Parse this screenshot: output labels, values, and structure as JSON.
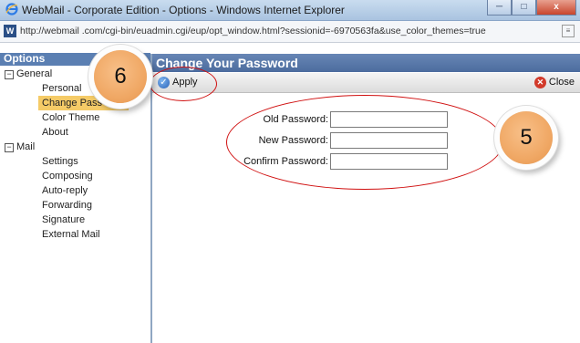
{
  "window": {
    "title": "WebMail - Corporate Edition - Options - Windows Internet Explorer",
    "minimize_label": "─",
    "maximize_label": "□",
    "close_label": "x"
  },
  "address_bar": {
    "url": "http://webmail         .com/cgi-bin/euadmin.cgi/eup/opt_window.html?sessionid=-6970563fa&use_color_themes=true"
  },
  "sidebar": {
    "header": "Options",
    "groups": [
      {
        "label": "General",
        "expander": "−",
        "items": [
          "Personal",
          "Change Pass",
          "Color Theme",
          "About"
        ],
        "selected": "Change Pass"
      },
      {
        "label": "Mail",
        "expander": "−",
        "items": [
          "Settings",
          "Composing",
          "Auto-reply",
          "Forwarding",
          "Signature",
          "External Mail"
        ]
      }
    ]
  },
  "main": {
    "title": "Change Your Password",
    "toolbar": {
      "apply_label": "Apply",
      "close_label": "Close"
    },
    "form": {
      "old_password_label": "Old Password:",
      "new_password_label": "New Password:",
      "confirm_password_label": "Confirm Password:"
    }
  },
  "annotations": {
    "badge_6": "6",
    "badge_5": "5",
    "highlight_color": "#d01010",
    "badge_color": "#f0a865"
  },
  "colors": {
    "header_blue": "#4c6c9e",
    "selected_item": "#f5cb67"
  }
}
